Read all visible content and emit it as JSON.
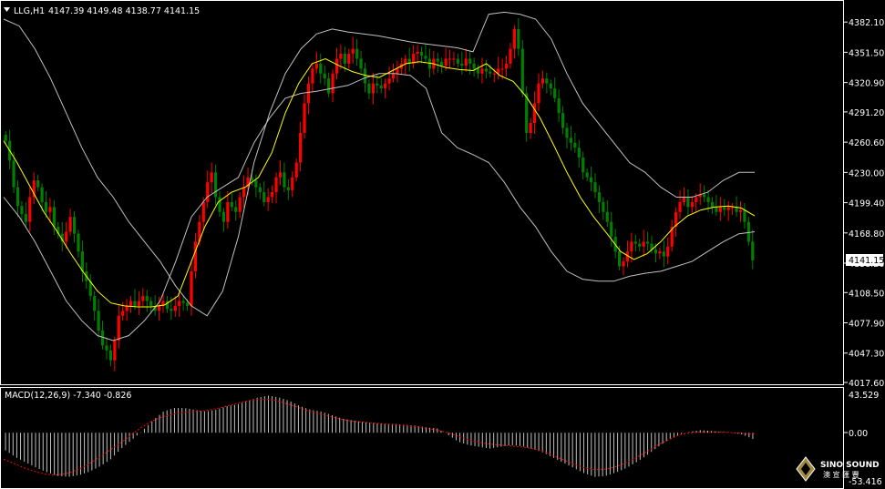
{
  "header": {
    "symbol": "LLG,H1",
    "ohlc": "4147.39 4149.48 4138.77 4141.15"
  },
  "current_price_label": "4141.15",
  "macd": {
    "label": "MACD(12,26,9) -7.340 -0.826",
    "max_label": "43.529",
    "zero_label": "0.00",
    "min_label": "-53.416"
  },
  "logo": {
    "name": "SINO SOUND",
    "cn": "澳 宣 匯 豐"
  },
  "colors": {
    "background": "#000000",
    "bull_candle": "#ff0000",
    "bear_candle": "#008000",
    "bollinger": "#c0c0c0",
    "ma": "#ffff00",
    "macd_hist": "#c0c0c0",
    "macd_signal": "#ff0000",
    "grid_frame": "#ffffff"
  },
  "chart_data": [
    {
      "type": "candlestick",
      "title": "LLG,H1",
      "ylim": [
        4017.6,
        4397
      ],
      "y_ticks": [
        "4382.10",
        "4351.50",
        "4320.90",
        "4291.20",
        "4260.60",
        "4230.00",
        "4199.40",
        "4168.80",
        "4138.20",
        "4108.50",
        "4077.90",
        "4047.30",
        "4017.60"
      ],
      "series": [
        {
          "name": "close",
          "values": [
            4262,
            4242,
            4215,
            4196,
            4188,
            4180,
            4205,
            4222,
            4215,
            4200,
            4190,
            4195,
            4175,
            4168,
            4160,
            4170,
            4185,
            4168,
            4150,
            4130,
            4120,
            4105,
            4090,
            4070,
            4055,
            4050,
            4040,
            4060,
            4085,
            4090,
            4095,
            4100,
            4095,
            4100,
            4105,
            4100,
            4095,
            4090,
            4095,
            4100,
            4092,
            4090,
            4095,
            4100,
            4098,
            4095,
            4130,
            4160,
            4180,
            4200,
            4220,
            4230,
            4205,
            4190,
            4180,
            4200,
            4195,
            4190,
            4205,
            4215,
            4225,
            4222,
            4215,
            4210,
            4200,
            4205,
            4210,
            4225,
            4230,
            4215,
            4212,
            4225,
            4240,
            4270,
            4300,
            4320,
            4335,
            4340,
            4330,
            4325,
            4310,
            4330,
            4345,
            4350,
            4340,
            4350,
            4355,
            4345,
            4335,
            4320,
            4310,
            4320,
            4318,
            4315,
            4320,
            4325,
            4330,
            4335,
            4340,
            4345,
            4340,
            4350,
            4352,
            4348,
            4345,
            4335,
            4345,
            4342,
            4338,
            4345,
            4345,
            4345,
            4340,
            4338,
            4345,
            4340,
            4335,
            4330,
            4335,
            4332,
            4330,
            4330,
            4335,
            4335,
            4340,
            4355,
            4375,
            4355,
            4310,
            4270,
            4280,
            4300,
            4320,
            4325,
            4320,
            4315,
            4305,
            4290,
            4275,
            4265,
            4260,
            4255,
            4245,
            4230,
            4225,
            4220,
            4210,
            4200,
            4190,
            4180,
            4165,
            4150,
            4135,
            4140,
            4150,
            4160,
            4158,
            4155,
            4160,
            4158,
            4152,
            4148,
            4150,
            4145,
            4155,
            4175,
            4190,
            4200,
            4205,
            4195,
            4200,
            4205,
            4208,
            4205,
            4200,
            4195,
            4190,
            4195,
            4192,
            4195,
            4195,
            4190,
            4192,
            4180,
            4160,
            4141.15
          ]
        },
        {
          "name": "bb_upper",
          "values": [
            4385,
            4378,
            4355,
            4325,
            4290,
            4255,
            4225,
            4205,
            4180,
            4160,
            4140,
            4115,
            4095,
            4085,
            4110,
            4165,
            4240,
            4290,
            4330,
            4355,
            4370,
            4375,
            4372,
            4370,
            4368,
            4365,
            4362,
            4360,
            4358,
            4356,
            4352,
            4390,
            4392,
            4390,
            4385,
            4365,
            4330,
            4300,
            4280,
            4260,
            4240,
            4230,
            4215,
            4205,
            4205,
            4210,
            4222,
            4230,
            4230
          ]
        },
        {
          "name": "bb_lower",
          "values": [
            4205,
            4185,
            4160,
            4130,
            4100,
            4080,
            4065,
            4060,
            4065,
            4080,
            4100,
            4140,
            4185,
            4205,
            4215,
            4225,
            4260,
            4285,
            4305,
            4310,
            4312,
            4315,
            4318,
            4325,
            4330,
            4330,
            4328,
            4315,
            4270,
            4255,
            4248,
            4240,
            4220,
            4195,
            4175,
            4150,
            4130,
            4122,
            4120,
            4120,
            4125,
            4128,
            4130,
            4135,
            4140,
            4150,
            4160,
            4168,
            4170
          ]
        },
        {
          "name": "ma",
          "values": [
            4262,
            4240,
            4215,
            4190,
            4170,
            4148,
            4128,
            4110,
            4098,
            4095,
            4094,
            4094,
            4096,
            4105,
            4140,
            4175,
            4200,
            4210,
            4215,
            4225,
            4250,
            4290,
            4320,
            4340,
            4345,
            4338,
            4332,
            4328,
            4326,
            4333,
            4340,
            4342,
            4340,
            4336,
            4334,
            4333,
            4340,
            4328,
            4322,
            4306,
            4285,
            4258,
            4230,
            4205,
            4185,
            4168,
            4150,
            4142,
            4148,
            4160,
            4175,
            4186,
            4192,
            4195,
            4196,
            4194,
            4186
          ]
        }
      ]
    },
    {
      "type": "bar",
      "title": "MACD(12,26,9) -7.340 -0.826",
      "ylim": [
        -53.416,
        43.529
      ],
      "series": [
        {
          "name": "macd",
          "values": [
            -20,
            -28,
            -34,
            -40,
            -45,
            -49,
            -50,
            -48,
            -44,
            -38,
            -30,
            -18,
            -8,
            2,
            14,
            24,
            28,
            28,
            26,
            24,
            26,
            30,
            32,
            36,
            40,
            42,
            40,
            36,
            30,
            26,
            24,
            20,
            16,
            14,
            12,
            11,
            10,
            10,
            9,
            8,
            6,
            5,
            -2,
            -10,
            -14,
            -16,
            -18,
            -16,
            -14,
            -15,
            -18,
            -22,
            -28,
            -34,
            -40,
            -46,
            -50,
            -49,
            -45,
            -40,
            -33,
            -25,
            -16,
            -8,
            -2,
            1,
            3,
            2,
            1,
            0,
            -2,
            -7
          ]
        },
        {
          "name": "signal",
          "values": [
            -30,
            -35,
            -40,
            -44,
            -47,
            -48,
            -46,
            -42,
            -36,
            -28,
            -20,
            -12,
            -3,
            6,
            13,
            18,
            21,
            23,
            24,
            25,
            27,
            30,
            33,
            36,
            38,
            38,
            36,
            32,
            28,
            24,
            21,
            18,
            15,
            13,
            12,
            11,
            10,
            9,
            8,
            7,
            5,
            3,
            0,
            -4,
            -8,
            -11,
            -13,
            -14,
            -15,
            -16,
            -18,
            -21,
            -26,
            -31,
            -36,
            -40,
            -42,
            -41,
            -38,
            -33,
            -27,
            -20,
            -13,
            -7,
            -2,
            0,
            1,
            1,
            1,
            0,
            -1,
            -1
          ]
        }
      ]
    }
  ]
}
